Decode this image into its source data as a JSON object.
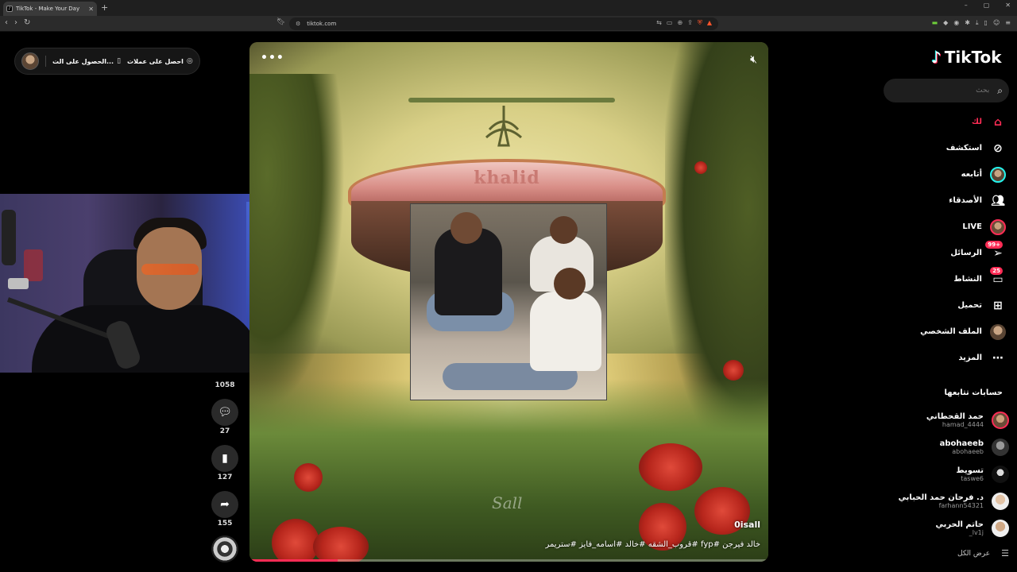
{
  "browser": {
    "tab_title": "TikTok - Make Your Day",
    "url": "tiktok.com",
    "new_tab": "+",
    "window_controls": [
      "–",
      "▢",
      "✕"
    ]
  },
  "top_pill": {
    "get_coins": "احصل على عملات",
    "get_app": "الحصول على الت..."
  },
  "actions": {
    "likes_count": "1058",
    "comments_count": "27",
    "saves_count": "127",
    "shares_count": "155"
  },
  "video": {
    "sign_text": "khalid",
    "watermark": "Sall",
    "author": "0isall",
    "caption": "خالد فيرجن #fyp #قروب_الشقه #خالد #اسامه_فايز #ستريمر",
    "progress": 0.17
  },
  "sidebar": {
    "logo": "TikTok",
    "search_placeholder": "بحث",
    "nav": [
      {
        "label": "لك",
        "icon": "home-icon",
        "active": true
      },
      {
        "label": "استكشف",
        "icon": "compass-icon"
      },
      {
        "label": "أتابعه",
        "icon": "following-avatar-icon"
      },
      {
        "label": "الأصدقاء",
        "icon": "friends-icon"
      },
      {
        "label": "LIVE",
        "icon": "live-avatar-icon"
      },
      {
        "label": "الرسائل",
        "icon": "messages-icon",
        "badge": "99+"
      },
      {
        "label": "النشاط",
        "icon": "activity-icon",
        "badge": "25"
      },
      {
        "label": "تحميل",
        "icon": "upload-icon"
      },
      {
        "label": "الملف الشخصي",
        "icon": "profile-avatar-icon"
      },
      {
        "label": "المزيد",
        "icon": "more-icon"
      }
    ],
    "following_title": "حسابات تتابعها",
    "following": [
      {
        "name": "حمد القحطاني",
        "handle": "hamad_4444"
      },
      {
        "name": "abohaeeb",
        "handle": "abohaeeb"
      },
      {
        "name": "تسويط",
        "handle": "taswe6"
      },
      {
        "name": "د. فرحان حمد الحبابي",
        "handle": "farhann54321"
      },
      {
        "name": "حاتم الحربي",
        "handle": "_lv1j"
      }
    ],
    "see_all": "عرض الكل"
  },
  "colors": {
    "accent": "#fe2c55",
    "cyan": "#25f4ee",
    "background": "#000000"
  }
}
